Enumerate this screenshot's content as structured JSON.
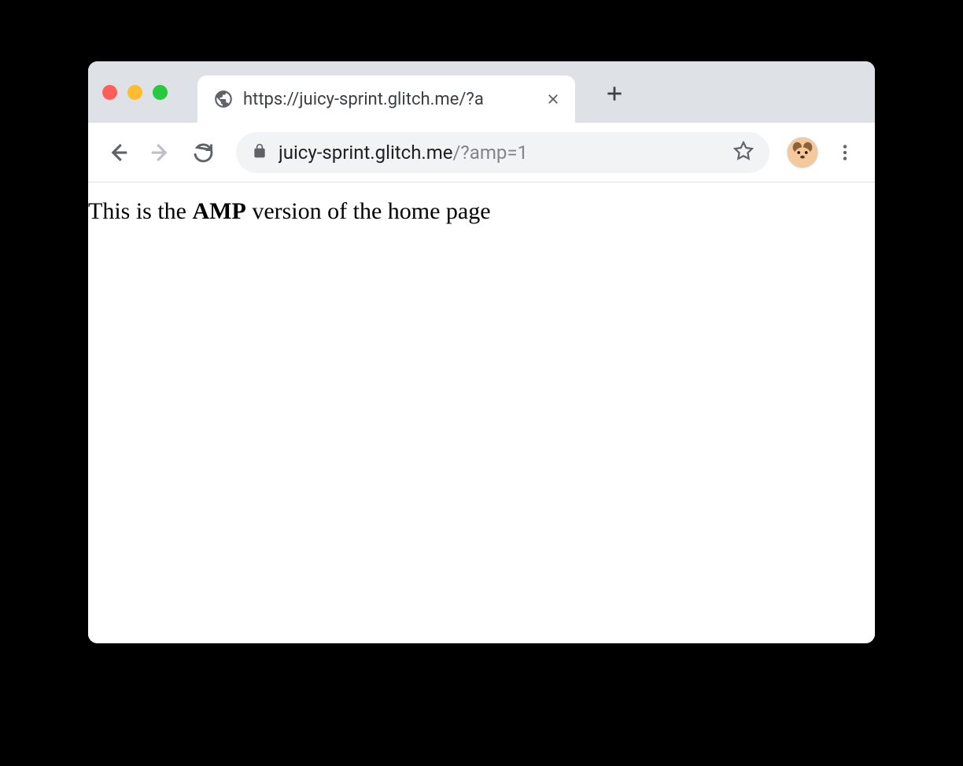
{
  "tab": {
    "title": "https://juicy-sprint.glitch.me/?a"
  },
  "address": {
    "host": "juicy-sprint.glitch.me",
    "path": "/?amp=1"
  },
  "page": {
    "text_before": "This is the ",
    "text_bold": "AMP",
    "text_after": " version of the home page"
  }
}
